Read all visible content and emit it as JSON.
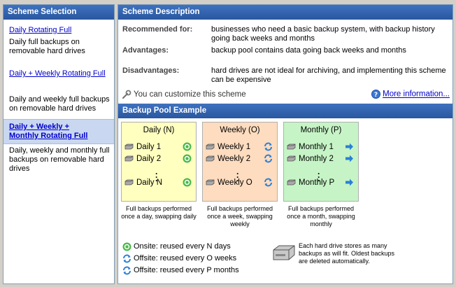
{
  "left_panel": {
    "title": "Scheme Selection",
    "schemes": [
      {
        "name": "Daily Rotating Full",
        "desc": "Daily full backups on removable hard drives"
      },
      {
        "name": "Daily + Weekly Rotating Full",
        "desc": "Daily and weekly full backups on removable hard drives"
      },
      {
        "name": "Daily + Weekly + Monthly Rotating Full",
        "desc": "Daily, weekly and monthly full backups on removable hard drives"
      }
    ]
  },
  "description": {
    "title": "Scheme Description",
    "recommended_label": "Recommended for:",
    "recommended_value": "businesses who need a basic backup system, with backup history going back weeks and months",
    "advantages_label": "Advantages:",
    "advantages_value": "backup pool contains data going back weeks and months",
    "disadvantages_label": "Disadvantages:",
    "disadvantages_value": "hard drives are not ideal for archiving, and implementing this scheme can be expensive",
    "customize_text": "You can customize this scheme",
    "more_info_link": "More information..."
  },
  "pool": {
    "title": "Backup Pool Example",
    "columns": [
      {
        "title": "Daily (N)",
        "items": [
          "Daily 1",
          "Daily 2",
          "Daily N"
        ],
        "caption": "Full backups performed once a day, swapping daily",
        "color": "#ffffc0"
      },
      {
        "title": "Weekly (O)",
        "items": [
          "Weekly 1",
          "Weekly 2",
          "Weekly O"
        ],
        "caption": "Full backups performed once a week, swapping weekly",
        "color": "#fddcbf"
      },
      {
        "title": "Monthly (P)",
        "items": [
          "Monthly 1",
          "Monthly 2",
          "Monthly P"
        ],
        "caption": "Full backups performed once a month, swapping monthly",
        "color": "#c6f4c6"
      }
    ],
    "legend": [
      {
        "icon": "recycle-onsite-icon",
        "text": "Onsite: reused every N days"
      },
      {
        "icon": "rotate-offsite-icon",
        "text": "Offsite: reused every O weeks"
      },
      {
        "icon": "rotate-offsite-monthly-icon",
        "text": "Offsite: reused every P months"
      }
    ],
    "note": "Each hard drive stores as many backups as will fit. Oldest backups are deleted automatically."
  }
}
